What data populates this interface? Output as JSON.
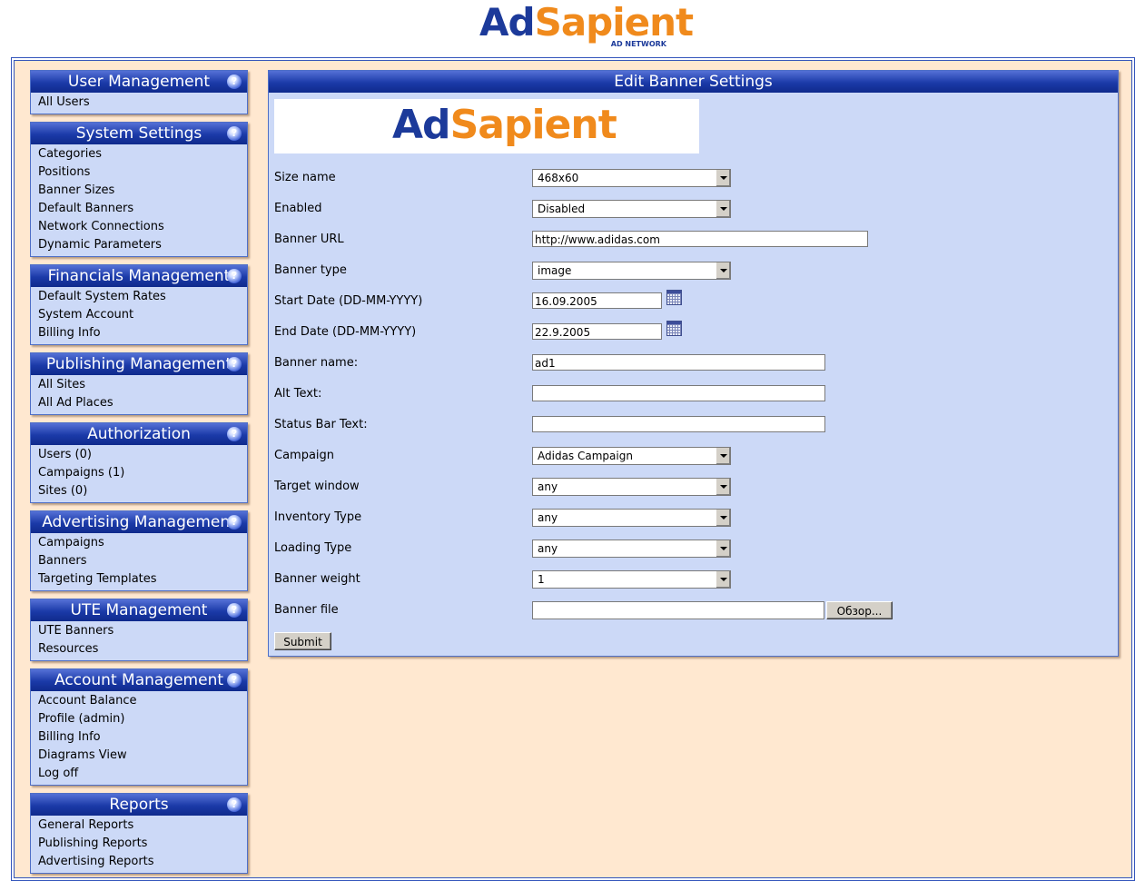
{
  "header": {
    "logo_text_1": "Ad",
    "logo_text_2": "Sapient",
    "logo_sub": "AD NETWORK"
  },
  "sidebar": [
    {
      "title": "User Management",
      "items": [
        "All Users"
      ]
    },
    {
      "title": "System Settings",
      "items": [
        "Categories",
        "Positions",
        "Banner Sizes",
        "Default Banners",
        "Network Connections",
        "Dynamic Parameters"
      ]
    },
    {
      "title": "Financials Management",
      "items": [
        "Default System Rates",
        "System Account",
        "Billing Info"
      ]
    },
    {
      "title": "Publishing Management",
      "items": [
        "All Sites",
        "All Ad Places"
      ]
    },
    {
      "title": "Authorization",
      "items": [
        "Users (0)",
        "Campaigns (1)",
        "Sites (0)"
      ]
    },
    {
      "title": "Advertising Management",
      "items": [
        "Campaigns",
        "Banners",
        "Targeting Templates"
      ]
    },
    {
      "title": "UTE Management",
      "items": [
        "UTE Banners",
        "Resources"
      ]
    },
    {
      "title": "Account Management",
      "items": [
        "Account Balance",
        "Profile (admin)",
        "Billing Info",
        "Diagrams View",
        "Log off"
      ]
    },
    {
      "title": "Reports",
      "items": [
        "General Reports",
        "Publishing Reports",
        "Advertising Reports"
      ]
    }
  ],
  "help_glyph": "?",
  "main": {
    "title": "Edit Banner Settings",
    "preview_logo_1": "Ad",
    "preview_logo_2": "Sapient",
    "fields": {
      "size_name": {
        "label": "Size name",
        "value": "468x60"
      },
      "enabled": {
        "label": "Enabled",
        "value": "Disabled"
      },
      "banner_url": {
        "label": "Banner URL",
        "value": "http://www.adidas.com"
      },
      "banner_type": {
        "label": "Banner type",
        "value": "image"
      },
      "start_date": {
        "label": "Start Date (DD-MM-YYYY)",
        "value": "16.09.2005"
      },
      "end_date": {
        "label": "End Date (DD-MM-YYYY)",
        "value": "22.9.2005"
      },
      "banner_name": {
        "label": "Banner name:",
        "value": "ad1"
      },
      "alt_text": {
        "label": "Alt Text:",
        "value": ""
      },
      "status_bar_text": {
        "label": "Status Bar Text:",
        "value": ""
      },
      "campaign": {
        "label": "Campaign",
        "value": "Adidas Campaign"
      },
      "target_window": {
        "label": "Target window",
        "value": "any"
      },
      "inventory_type": {
        "label": "Inventory Type",
        "value": "any"
      },
      "loading_type": {
        "label": "Loading Type",
        "value": "any"
      },
      "banner_weight": {
        "label": "Banner weight",
        "value": "1"
      },
      "banner_file": {
        "label": "Banner file",
        "value": "",
        "browse_label": "Обзор..."
      }
    },
    "submit_label": "Submit"
  },
  "colors": {
    "header_blue": "#1b3aa8",
    "panel_bg": "#ccd9f7",
    "page_bg": "#ffe8d0",
    "logo_orange": "#f08a1c"
  }
}
